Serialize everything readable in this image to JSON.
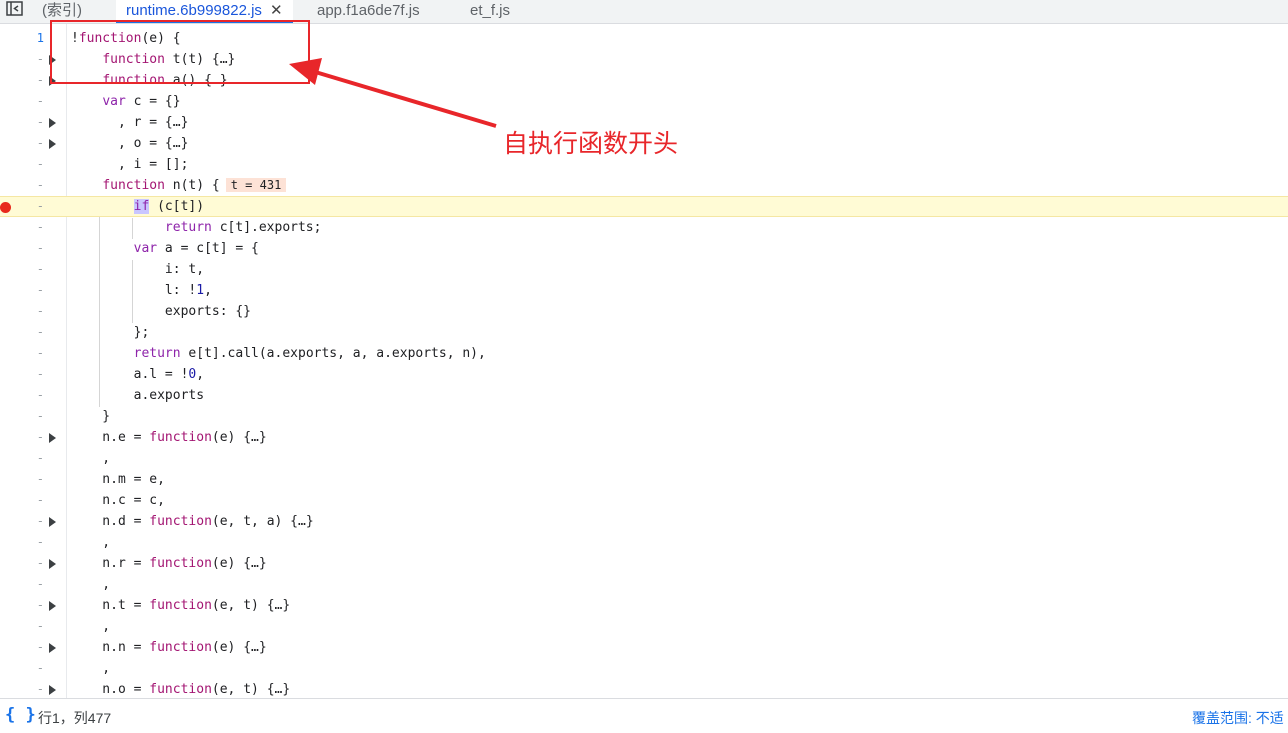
{
  "tabs": {
    "toggle_icon": "sidebar-toggle-icon",
    "items": [
      {
        "label": "(索引)"
      },
      {
        "label": "runtime.6b999822.js",
        "active": true,
        "close": "✕"
      },
      {
        "label": "app.f1a6de7f.js"
      },
      {
        "label": "et_f.js"
      }
    ]
  },
  "editor": {
    "line_numbers": [
      "1",
      "-",
      "-",
      "-",
      "-",
      "-",
      "-",
      "-",
      "-",
      "-",
      "-",
      "-",
      "-",
      "-",
      "-",
      "-",
      "-",
      "-",
      "-",
      "-",
      "-",
      "-",
      "-",
      "-",
      "-",
      "-",
      "-",
      "-",
      "-",
      "-",
      "-",
      "-",
      "-"
    ],
    "lines": [
      "!function(e) {",
      "    function t(t) {…}",
      "    function a() {…}",
      "    var c = {}",
      "      , r = {…}",
      "      , o = {…}",
      "      , i = [];",
      "    function n(t) {",
      "        if (c[t])",
      "            return c[t].exports;",
      "        var a = c[t] = {",
      "            i: t,",
      "            l: !1,",
      "            exports: {}",
      "        };",
      "        return e[t].call(a.exports, a, a.exports, n),",
      "        a.l = !0,",
      "        a.exports",
      "    }",
      "    n.e = function(e) {…}",
      "    ,",
      "    n.m = e,",
      "    n.c = c,",
      "    n.d = function(e, t, a) {…}",
      "    ,",
      "    n.r = function(e) {…}",
      "    ,",
      "    n.t = function(e, t) {…}",
      "    ,",
      "    n.n = function(e) {…}",
      "    ,",
      "    n.o = function(e, t) {…}"
    ],
    "inline_value": "t = 431",
    "paused_line": 9
  },
  "annotation": {
    "text": "自执行函数开头",
    "color": "#e8262a"
  },
  "status": {
    "format_icon": "{ }",
    "position": "行1，列477",
    "coverage": "覆盖范围: 不适"
  }
}
